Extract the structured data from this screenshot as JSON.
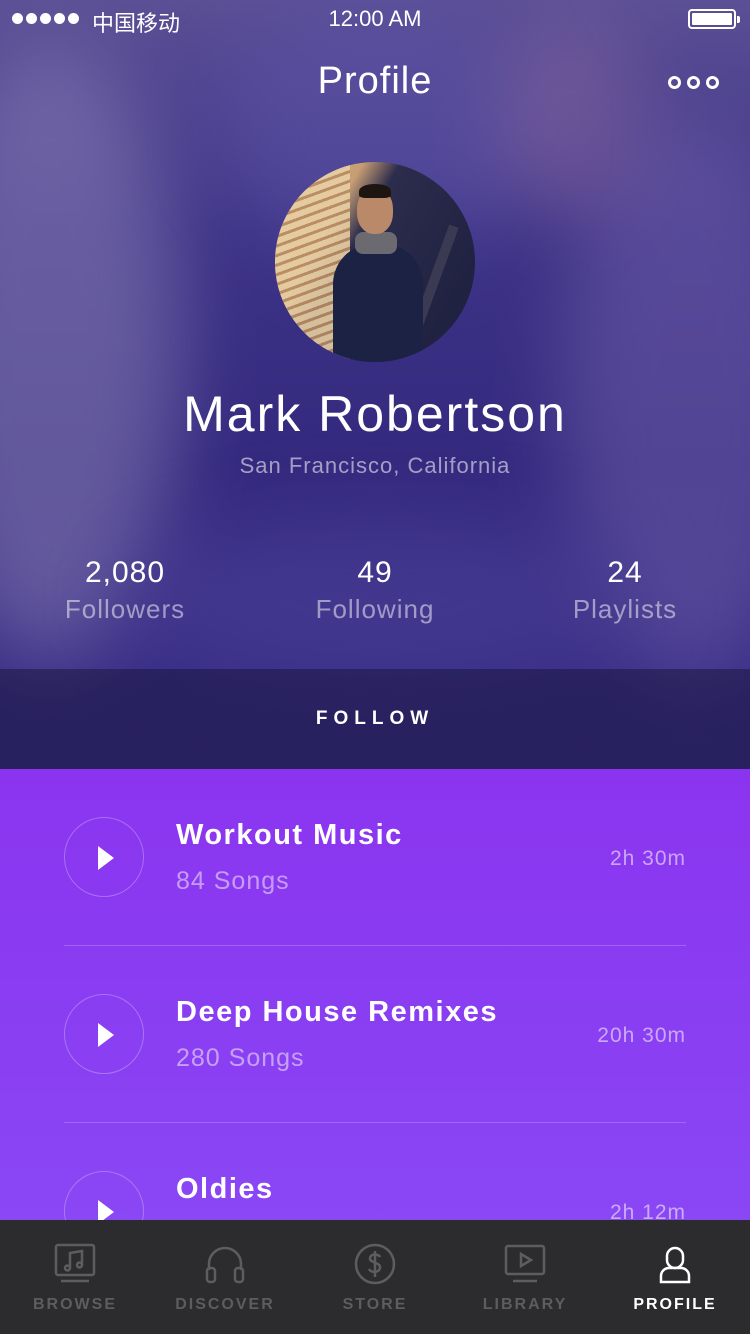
{
  "status_bar": {
    "carrier": "中国移动",
    "time": "12:00 AM"
  },
  "header": {
    "title": "Profile",
    "more_icon": "more-dots-icon"
  },
  "profile": {
    "name": "Mark Robertson",
    "location": "San Francisco, California",
    "stats": [
      {
        "value": "2,080",
        "label": "Followers"
      },
      {
        "value": "49",
        "label": "Following"
      },
      {
        "value": "24",
        "label": "Playlists"
      }
    ],
    "follow_label": "FOLLOW"
  },
  "playlists": [
    {
      "title": "Workout Music",
      "songs": "84 Songs",
      "duration": "2h 30m"
    },
    {
      "title": "Deep House Remixes",
      "songs": "280 Songs",
      "duration": "20h 30m"
    },
    {
      "title": "Oldies",
      "songs": "",
      "duration": "2h 12m"
    }
  ],
  "tabbar": {
    "tabs": [
      {
        "label": "BROWSE",
        "icon": "music-note-icon",
        "active": false
      },
      {
        "label": "DISCOVER",
        "icon": "headphones-icon",
        "active": false
      },
      {
        "label": "STORE",
        "icon": "dollar-icon",
        "active": false
      },
      {
        "label": "LIBRARY",
        "icon": "video-play-icon",
        "active": false
      },
      {
        "label": "PROFILE",
        "icon": "user-icon",
        "active": true
      }
    ]
  },
  "colors": {
    "playlist_bg": "#8b34f0",
    "tabbar_bg": "#2c2c2e",
    "tab_inactive": "#5d5d60",
    "tab_active": "#ffffff"
  }
}
